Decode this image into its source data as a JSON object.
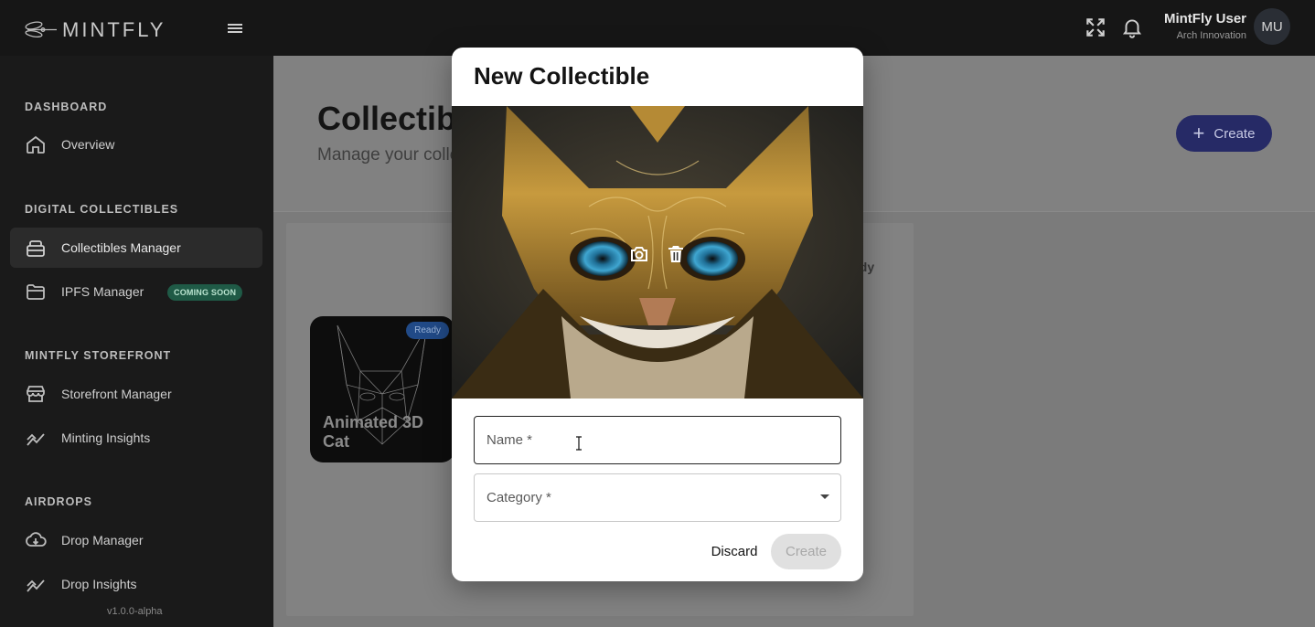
{
  "app": {
    "logo_text": "MINTFLY",
    "version": "v1.0.0-alpha"
  },
  "topbar": {
    "fullscreen_icon": "fullscreen-icon",
    "notifications_icon": "bell-icon",
    "user_name": "MintFly User",
    "user_org": "Arch Innovation",
    "avatar_initials": "MU"
  },
  "sidebar": {
    "sections": [
      {
        "title": "DASHBOARD",
        "items": [
          {
            "label": "Overview",
            "icon": "home-icon"
          }
        ]
      },
      {
        "title": "DIGITAL COLLECTIBLES",
        "items": [
          {
            "label": "Collectibles Manager",
            "icon": "collectibles-icon",
            "active": true
          },
          {
            "label": "IPFS Manager",
            "icon": "folder-icon",
            "badge": "COMING SOON"
          }
        ]
      },
      {
        "title": "MINTFLY STOREFRONT",
        "items": [
          {
            "label": "Storefront Manager",
            "icon": "storefront-icon"
          },
          {
            "label": "Minting Insights",
            "icon": "insights-icon"
          }
        ]
      },
      {
        "title": "AIRDROPS",
        "items": [
          {
            "label": "Drop Manager",
            "icon": "cloud-download-icon"
          },
          {
            "label": "Drop Insights",
            "icon": "insights-icon"
          }
        ]
      }
    ]
  },
  "main": {
    "title": "Collectibl",
    "subtitle": "Manage your colle",
    "create_label": "Create",
    "status_fragment": "ady",
    "card": {
      "title": "Animated 3D Cat",
      "status": "Ready"
    }
  },
  "modal": {
    "title": "New Collectible",
    "image_actions": [
      "camera-icon",
      "trash-icon"
    ],
    "name_label": "Name *",
    "category_label": "Category *",
    "discard_label": "Discard",
    "create_label": "Create"
  },
  "colors": {
    "accent": "#262a66",
    "badge_green": "#1f5a46",
    "ready_blue": "#214a87"
  }
}
